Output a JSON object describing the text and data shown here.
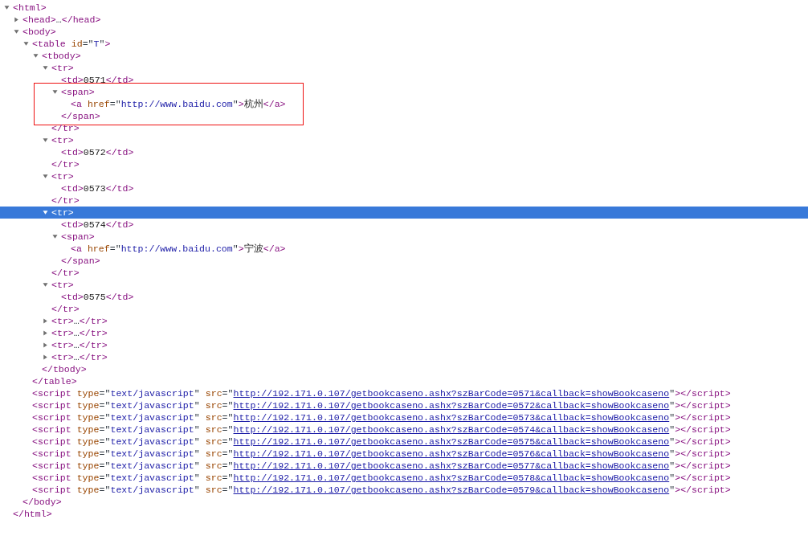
{
  "tree": [
    {
      "kind": "element",
      "expanded": true,
      "selected": false,
      "open": [
        {
          "kind": "tag",
          "text": "<html>"
        }
      ],
      "close": [
        {
          "kind": "tag",
          "text": "</html>"
        }
      ],
      "children": [
        {
          "kind": "element",
          "expanded": false,
          "selected": false,
          "open": [
            {
              "kind": "tag",
              "text": "<head>"
            },
            {
              "kind": "punct",
              "text": "…"
            },
            {
              "kind": "tag",
              "text": "</head>"
            }
          ]
        },
        {
          "kind": "element",
          "expanded": true,
          "selected": false,
          "open": [
            {
              "kind": "tag",
              "text": "<body>"
            }
          ],
          "close": [
            {
              "kind": "tag",
              "text": "</body>"
            }
          ],
          "children": [
            {
              "kind": "element",
              "expanded": true,
              "selected": false,
              "open": [
                {
                  "kind": "tag",
                  "text": "<table"
                },
                {
                  "kind": "attr",
                  "text": " id"
                },
                {
                  "kind": "punct",
                  "text": "=\""
                },
                {
                  "kind": "value",
                  "text": "T"
                },
                {
                  "kind": "punct",
                  "text": "\""
                },
                {
                  "kind": "tag",
                  "text": ">"
                }
              ],
              "close": [
                {
                  "kind": "tag",
                  "text": "</table>"
                }
              ],
              "children": [
                {
                  "kind": "element",
                  "expanded": true,
                  "selected": false,
                  "open": [
                    {
                      "kind": "tag",
                      "text": "<tbody>"
                    }
                  ],
                  "close": [
                    {
                      "kind": "tag",
                      "text": "</tbody>"
                    }
                  ],
                  "children": [
                    {
                      "kind": "element",
                      "expanded": true,
                      "selected": false,
                      "open": [
                        {
                          "kind": "tag",
                          "text": "<tr>"
                        }
                      ],
                      "close": [
                        {
                          "kind": "tag",
                          "text": "</tr>"
                        }
                      ],
                      "children": [
                        {
                          "kind": "leaf",
                          "selected": false,
                          "open": [
                            {
                              "kind": "tag",
                              "text": "<td>"
                            },
                            {
                              "kind": "text",
                              "text": "0571"
                            },
                            {
                              "kind": "tag",
                              "text": "</td>"
                            }
                          ]
                        },
                        {
                          "kind": "element",
                          "expanded": true,
                          "selected": false,
                          "boxed": true,
                          "open": [
                            {
                              "kind": "tag",
                              "text": "<span>"
                            }
                          ],
                          "close": [
                            {
                              "kind": "tag",
                              "text": "</span>"
                            }
                          ],
                          "children": [
                            {
                              "kind": "leaf",
                              "selected": false,
                              "open": [
                                {
                                  "kind": "tag",
                                  "text": "<a"
                                },
                                {
                                  "kind": "attr",
                                  "text": " href"
                                },
                                {
                                  "kind": "punct",
                                  "text": "=\""
                                },
                                {
                                  "kind": "value",
                                  "text": "http://www.baidu.com"
                                },
                                {
                                  "kind": "punct",
                                  "text": "\""
                                },
                                {
                                  "kind": "tag",
                                  "text": ">"
                                },
                                {
                                  "kind": "text",
                                  "text": "杭州"
                                },
                                {
                                  "kind": "tag",
                                  "text": "</a>"
                                }
                              ]
                            }
                          ]
                        }
                      ]
                    },
                    {
                      "kind": "element",
                      "expanded": true,
                      "selected": false,
                      "open": [
                        {
                          "kind": "tag",
                          "text": "<tr>"
                        }
                      ],
                      "close": [
                        {
                          "kind": "tag",
                          "text": "</tr>"
                        }
                      ],
                      "children": [
                        {
                          "kind": "leaf",
                          "selected": false,
                          "open": [
                            {
                              "kind": "tag",
                              "text": "<td>"
                            },
                            {
                              "kind": "text",
                              "text": "0572"
                            },
                            {
                              "kind": "tag",
                              "text": "</td>"
                            }
                          ]
                        }
                      ]
                    },
                    {
                      "kind": "element",
                      "expanded": true,
                      "selected": false,
                      "open": [
                        {
                          "kind": "tag",
                          "text": "<tr>"
                        }
                      ],
                      "close": [
                        {
                          "kind": "tag",
                          "text": "</tr>"
                        }
                      ],
                      "children": [
                        {
                          "kind": "leaf",
                          "selected": false,
                          "open": [
                            {
                              "kind": "tag",
                              "text": "<td>"
                            },
                            {
                              "kind": "text",
                              "text": "0573"
                            },
                            {
                              "kind": "tag",
                              "text": "</td>"
                            }
                          ]
                        }
                      ]
                    },
                    {
                      "kind": "element",
                      "expanded": true,
                      "selected": true,
                      "open": [
                        {
                          "kind": "tag",
                          "text": "<tr>"
                        }
                      ],
                      "close": [
                        {
                          "kind": "tag",
                          "text": "</tr>"
                        }
                      ],
                      "children": [
                        {
                          "kind": "leaf",
                          "selected": false,
                          "open": [
                            {
                              "kind": "tag",
                              "text": "<td>"
                            },
                            {
                              "kind": "text",
                              "text": "0574"
                            },
                            {
                              "kind": "tag",
                              "text": "</td>"
                            }
                          ]
                        },
                        {
                          "kind": "element",
                          "expanded": true,
                          "selected": false,
                          "open": [
                            {
                              "kind": "tag",
                              "text": "<span>"
                            }
                          ],
                          "close": [
                            {
                              "kind": "tag",
                              "text": "</span>"
                            }
                          ],
                          "children": [
                            {
                              "kind": "leaf",
                              "selected": false,
                              "open": [
                                {
                                  "kind": "tag",
                                  "text": "<a"
                                },
                                {
                                  "kind": "attr",
                                  "text": " href"
                                },
                                {
                                  "kind": "punct",
                                  "text": "=\""
                                },
                                {
                                  "kind": "value",
                                  "text": "http://www.baidu.com"
                                },
                                {
                                  "kind": "punct",
                                  "text": "\""
                                },
                                {
                                  "kind": "tag",
                                  "text": ">"
                                },
                                {
                                  "kind": "text",
                                  "text": "宁波"
                                },
                                {
                                  "kind": "tag",
                                  "text": "</a>"
                                }
                              ]
                            }
                          ]
                        }
                      ]
                    },
                    {
                      "kind": "element",
                      "expanded": true,
                      "selected": false,
                      "open": [
                        {
                          "kind": "tag",
                          "text": "<tr>"
                        }
                      ],
                      "close": [
                        {
                          "kind": "tag",
                          "text": "</tr>"
                        }
                      ],
                      "children": [
                        {
                          "kind": "leaf",
                          "selected": false,
                          "open": [
                            {
                              "kind": "tag",
                              "text": "<td>"
                            },
                            {
                              "kind": "text",
                              "text": "0575"
                            },
                            {
                              "kind": "tag",
                              "text": "</td>"
                            }
                          ]
                        }
                      ]
                    },
                    {
                      "kind": "element",
                      "expanded": false,
                      "selected": false,
                      "open": [
                        {
                          "kind": "tag",
                          "text": "<tr>"
                        },
                        {
                          "kind": "punct",
                          "text": "…"
                        },
                        {
                          "kind": "tag",
                          "text": "</tr>"
                        }
                      ]
                    },
                    {
                      "kind": "element",
                      "expanded": false,
                      "selected": false,
                      "open": [
                        {
                          "kind": "tag",
                          "text": "<tr>"
                        },
                        {
                          "kind": "punct",
                          "text": "…"
                        },
                        {
                          "kind": "tag",
                          "text": "</tr>"
                        }
                      ]
                    },
                    {
                      "kind": "element",
                      "expanded": false,
                      "selected": false,
                      "open": [
                        {
                          "kind": "tag",
                          "text": "<tr>"
                        },
                        {
                          "kind": "punct",
                          "text": "…"
                        },
                        {
                          "kind": "tag",
                          "text": "</tr>"
                        }
                      ]
                    },
                    {
                      "kind": "element",
                      "expanded": false,
                      "selected": false,
                      "open": [
                        {
                          "kind": "tag",
                          "text": "<tr>"
                        },
                        {
                          "kind": "punct",
                          "text": "…"
                        },
                        {
                          "kind": "tag",
                          "text": "</tr>"
                        }
                      ]
                    }
                  ]
                }
              ]
            },
            {
              "kind": "leaf",
              "selected": false,
              "open": [
                {
                  "kind": "tag",
                  "text": "<script"
                },
                {
                  "kind": "attr",
                  "text": " type"
                },
                {
                  "kind": "punct",
                  "text": "=\""
                },
                {
                  "kind": "value",
                  "text": "text/javascript"
                },
                {
                  "kind": "punct",
                  "text": "\""
                },
                {
                  "kind": "attr",
                  "text": " src"
                },
                {
                  "kind": "punct",
                  "text": "=\""
                },
                {
                  "kind": "link",
                  "text": "http://192.171.0.107/getbookcaseno.ashx?szBarCode=0571&callback=showBookcaseno"
                },
                {
                  "kind": "punct",
                  "text": "\""
                },
                {
                  "kind": "tag",
                  "text": "></script>"
                }
              ]
            },
            {
              "kind": "leaf",
              "selected": false,
              "open": [
                {
                  "kind": "tag",
                  "text": "<script"
                },
                {
                  "kind": "attr",
                  "text": " type"
                },
                {
                  "kind": "punct",
                  "text": "=\""
                },
                {
                  "kind": "value",
                  "text": "text/javascript"
                },
                {
                  "kind": "punct",
                  "text": "\""
                },
                {
                  "kind": "attr",
                  "text": " src"
                },
                {
                  "kind": "punct",
                  "text": "=\""
                },
                {
                  "kind": "link",
                  "text": "http://192.171.0.107/getbookcaseno.ashx?szBarCode=0572&callback=showBookcaseno"
                },
                {
                  "kind": "punct",
                  "text": "\""
                },
                {
                  "kind": "tag",
                  "text": "></script>"
                }
              ]
            },
            {
              "kind": "leaf",
              "selected": false,
              "open": [
                {
                  "kind": "tag",
                  "text": "<script"
                },
                {
                  "kind": "attr",
                  "text": " type"
                },
                {
                  "kind": "punct",
                  "text": "=\""
                },
                {
                  "kind": "value",
                  "text": "text/javascript"
                },
                {
                  "kind": "punct",
                  "text": "\""
                },
                {
                  "kind": "attr",
                  "text": " src"
                },
                {
                  "kind": "punct",
                  "text": "=\""
                },
                {
                  "kind": "link",
                  "text": "http://192.171.0.107/getbookcaseno.ashx?szBarCode=0573&callback=showBookcaseno"
                },
                {
                  "kind": "punct",
                  "text": "\""
                },
                {
                  "kind": "tag",
                  "text": "></script>"
                }
              ]
            },
            {
              "kind": "leaf",
              "selected": false,
              "open": [
                {
                  "kind": "tag",
                  "text": "<script"
                },
                {
                  "kind": "attr",
                  "text": " type"
                },
                {
                  "kind": "punct",
                  "text": "=\""
                },
                {
                  "kind": "value",
                  "text": "text/javascript"
                },
                {
                  "kind": "punct",
                  "text": "\""
                },
                {
                  "kind": "attr",
                  "text": " src"
                },
                {
                  "kind": "punct",
                  "text": "=\""
                },
                {
                  "kind": "link",
                  "text": "http://192.171.0.107/getbookcaseno.ashx?szBarCode=0574&callback=showBookcaseno"
                },
                {
                  "kind": "punct",
                  "text": "\""
                },
                {
                  "kind": "tag",
                  "text": "></script>"
                }
              ]
            },
            {
              "kind": "leaf",
              "selected": false,
              "open": [
                {
                  "kind": "tag",
                  "text": "<script"
                },
                {
                  "kind": "attr",
                  "text": " type"
                },
                {
                  "kind": "punct",
                  "text": "=\""
                },
                {
                  "kind": "value",
                  "text": "text/javascript"
                },
                {
                  "kind": "punct",
                  "text": "\""
                },
                {
                  "kind": "attr",
                  "text": " src"
                },
                {
                  "kind": "punct",
                  "text": "=\""
                },
                {
                  "kind": "link",
                  "text": "http://192.171.0.107/getbookcaseno.ashx?szBarCode=0575&callback=showBookcaseno"
                },
                {
                  "kind": "punct",
                  "text": "\""
                },
                {
                  "kind": "tag",
                  "text": "></script>"
                }
              ]
            },
            {
              "kind": "leaf",
              "selected": false,
              "open": [
                {
                  "kind": "tag",
                  "text": "<script"
                },
                {
                  "kind": "attr",
                  "text": " type"
                },
                {
                  "kind": "punct",
                  "text": "=\""
                },
                {
                  "kind": "value",
                  "text": "text/javascript"
                },
                {
                  "kind": "punct",
                  "text": "\""
                },
                {
                  "kind": "attr",
                  "text": " src"
                },
                {
                  "kind": "punct",
                  "text": "=\""
                },
                {
                  "kind": "link",
                  "text": "http://192.171.0.107/getbookcaseno.ashx?szBarCode=0576&callback=showBookcaseno"
                },
                {
                  "kind": "punct",
                  "text": "\""
                },
                {
                  "kind": "tag",
                  "text": "></script>"
                }
              ]
            },
            {
              "kind": "leaf",
              "selected": false,
              "open": [
                {
                  "kind": "tag",
                  "text": "<script"
                },
                {
                  "kind": "attr",
                  "text": " type"
                },
                {
                  "kind": "punct",
                  "text": "=\""
                },
                {
                  "kind": "value",
                  "text": "text/javascript"
                },
                {
                  "kind": "punct",
                  "text": "\""
                },
                {
                  "kind": "attr",
                  "text": " src"
                },
                {
                  "kind": "punct",
                  "text": "=\""
                },
                {
                  "kind": "link",
                  "text": "http://192.171.0.107/getbookcaseno.ashx?szBarCode=0577&callback=showBookcaseno"
                },
                {
                  "kind": "punct",
                  "text": "\""
                },
                {
                  "kind": "tag",
                  "text": "></script>"
                }
              ]
            },
            {
              "kind": "leaf",
              "selected": false,
              "open": [
                {
                  "kind": "tag",
                  "text": "<script"
                },
                {
                  "kind": "attr",
                  "text": " type"
                },
                {
                  "kind": "punct",
                  "text": "=\""
                },
                {
                  "kind": "value",
                  "text": "text/javascript"
                },
                {
                  "kind": "punct",
                  "text": "\""
                },
                {
                  "kind": "attr",
                  "text": " src"
                },
                {
                  "kind": "punct",
                  "text": "=\""
                },
                {
                  "kind": "link",
                  "text": "http://192.171.0.107/getbookcaseno.ashx?szBarCode=0578&callback=showBookcaseno"
                },
                {
                  "kind": "punct",
                  "text": "\""
                },
                {
                  "kind": "tag",
                  "text": "></script>"
                }
              ]
            },
            {
              "kind": "leaf",
              "selected": false,
              "open": [
                {
                  "kind": "tag",
                  "text": "<script"
                },
                {
                  "kind": "attr",
                  "text": " type"
                },
                {
                  "kind": "punct",
                  "text": "=\""
                },
                {
                  "kind": "value",
                  "text": "text/javascript"
                },
                {
                  "kind": "punct",
                  "text": "\""
                },
                {
                  "kind": "attr",
                  "text": " src"
                },
                {
                  "kind": "punct",
                  "text": "=\""
                },
                {
                  "kind": "link",
                  "text": "http://192.171.0.107/getbookcaseno.ashx?szBarCode=0579&callback=showBookcaseno"
                },
                {
                  "kind": "punct",
                  "text": "\""
                },
                {
                  "kind": "tag",
                  "text": "></script>"
                }
              ]
            }
          ]
        }
      ]
    }
  ]
}
